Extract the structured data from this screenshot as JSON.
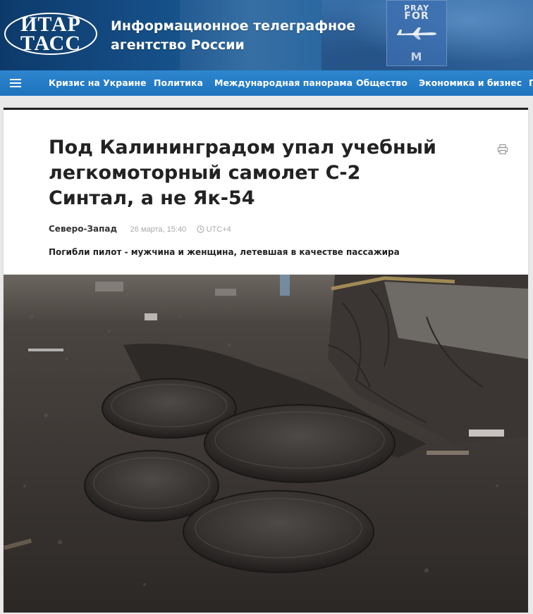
{
  "header": {
    "logo_line1": "ИТАР",
    "logo_line2": "ТАСС",
    "tagline_line1": "Информационное телеграфное",
    "tagline_line2": "агентство России",
    "banner_text_1": "PRAY",
    "banner_text_2": "FOR",
    "banner_text_3": "M"
  },
  "nav": {
    "menu_icon": "hamburger-icon",
    "items": [
      "Кризис на Украине",
      "Политика",
      "Международная панорама",
      "Общество",
      "Экономика и бизнес",
      "Г"
    ]
  },
  "article": {
    "title": "Под Калининградом упал учебный легкомоторный самолет С-2 Синтал, а не Як-54",
    "region": "Северо-Запад",
    "date": "26 марта, 15:40",
    "timezone": "UTC+4",
    "lead": "Погибли пилот - мужчина и женщина, летевшая в качестве пассажира",
    "print_icon": "printer-icon",
    "photo_description_icon": "photo"
  },
  "colors": {
    "header_dark": "#0d3a6b",
    "nav_blue": "#1e73bd",
    "title_text": "#222222",
    "meta_gray": "#aaaaaa"
  }
}
